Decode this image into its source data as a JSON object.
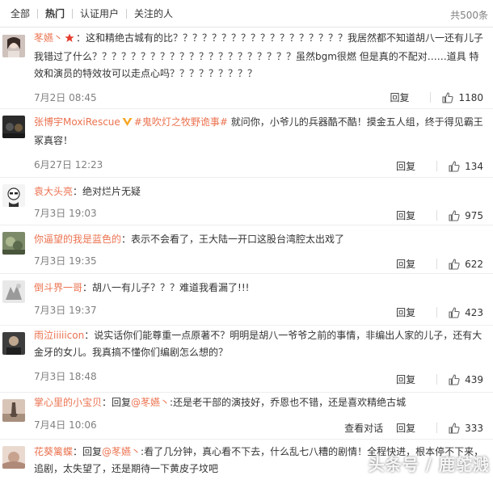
{
  "tabs": {
    "all": "全部",
    "hot": "热门",
    "verified": "认证用户",
    "following": "关注的人",
    "total": "共500条"
  },
  "comments": [
    {
      "user": "苳嬿丶",
      "text": "：这和精绝古城有的比？？？？？？？？？？？？？？？？？？我居然都不知道胡八一还有儿子 我错过了什么？？？？？？？？？？？？？？？？？？？？？虽然bgm很燃 但是真的不配对……道具 特效和演员的特效妆可以走点心吗？？？？？？？？？",
      "time": "7月2日 08:45",
      "reply": "回复",
      "likes": "1180"
    },
    {
      "user": "张博宇MoxiRescue",
      "topic": "#鬼吹灯之牧野诡事#",
      "text": " 就问你，小爷儿的兵器酷不酷！摸金五人组，终于得见霸王冢真容！",
      "time": "6月27日 12:23",
      "reply": "回复",
      "likes": "134"
    },
    {
      "user": "袁大头亮",
      "text": "：绝对烂片无疑",
      "time": "7月3日 19:03",
      "reply": "回复",
      "likes": "975"
    },
    {
      "user": "你逼望的我是蓝色的",
      "text": "：表示不会看了，王大陆一开口这股台湾腔太出戏了",
      "time": "7月3日 19:35",
      "reply": "回复",
      "likes": "622"
    },
    {
      "user": "倒斗界一哥",
      "text": "：胡八一有儿子？？？难道我看漏了!!!",
      "time": "7月3日 19:37",
      "reply": "回复",
      "likes": "423"
    },
    {
      "user": "雨泣iiiiicon",
      "text": "：说实话你们能尊重一点原著不？明明是胡八一爷爷之前的事情，非编出人家的儿子，还有大金牙的女儿。我真搞不懂你们编剧怎么想的？",
      "time": "7月3日 18:48",
      "reply": "回复",
      "likes": "439"
    },
    {
      "user": "掌心里的小宝贝",
      "reply_prefix": "：回复",
      "mention": "@苳嬿丶",
      "text": ":还是老干部的演技好，乔恩也不错，还是喜欢精绝古城",
      "time": "7月4日 10:06",
      "view_conversation": "查看对话",
      "reply": "回复",
      "likes": "333"
    },
    {
      "user": "花葵篱蝶",
      "reply_prefix": "：回复",
      "mention": "@苳嬿丶",
      "text": ":看了几分钟，真心看不下去，什么乱七八糟的剧情！全程快进，根本停不下来，追剧，太失望了，还是期待一下黄皮子坟吧"
    }
  ],
  "watermark": "头条号 / 鹿鸵溅",
  "colors": {
    "username": "#eb7350",
    "topic": "#eb7350",
    "meta": "#808080",
    "star_badge": "#e63b2e",
    "vip_badge": "#f5a623"
  },
  "icons": [
    "thumbs-up-icon",
    "star-badge-icon",
    "vip-v-badge-icon"
  ]
}
